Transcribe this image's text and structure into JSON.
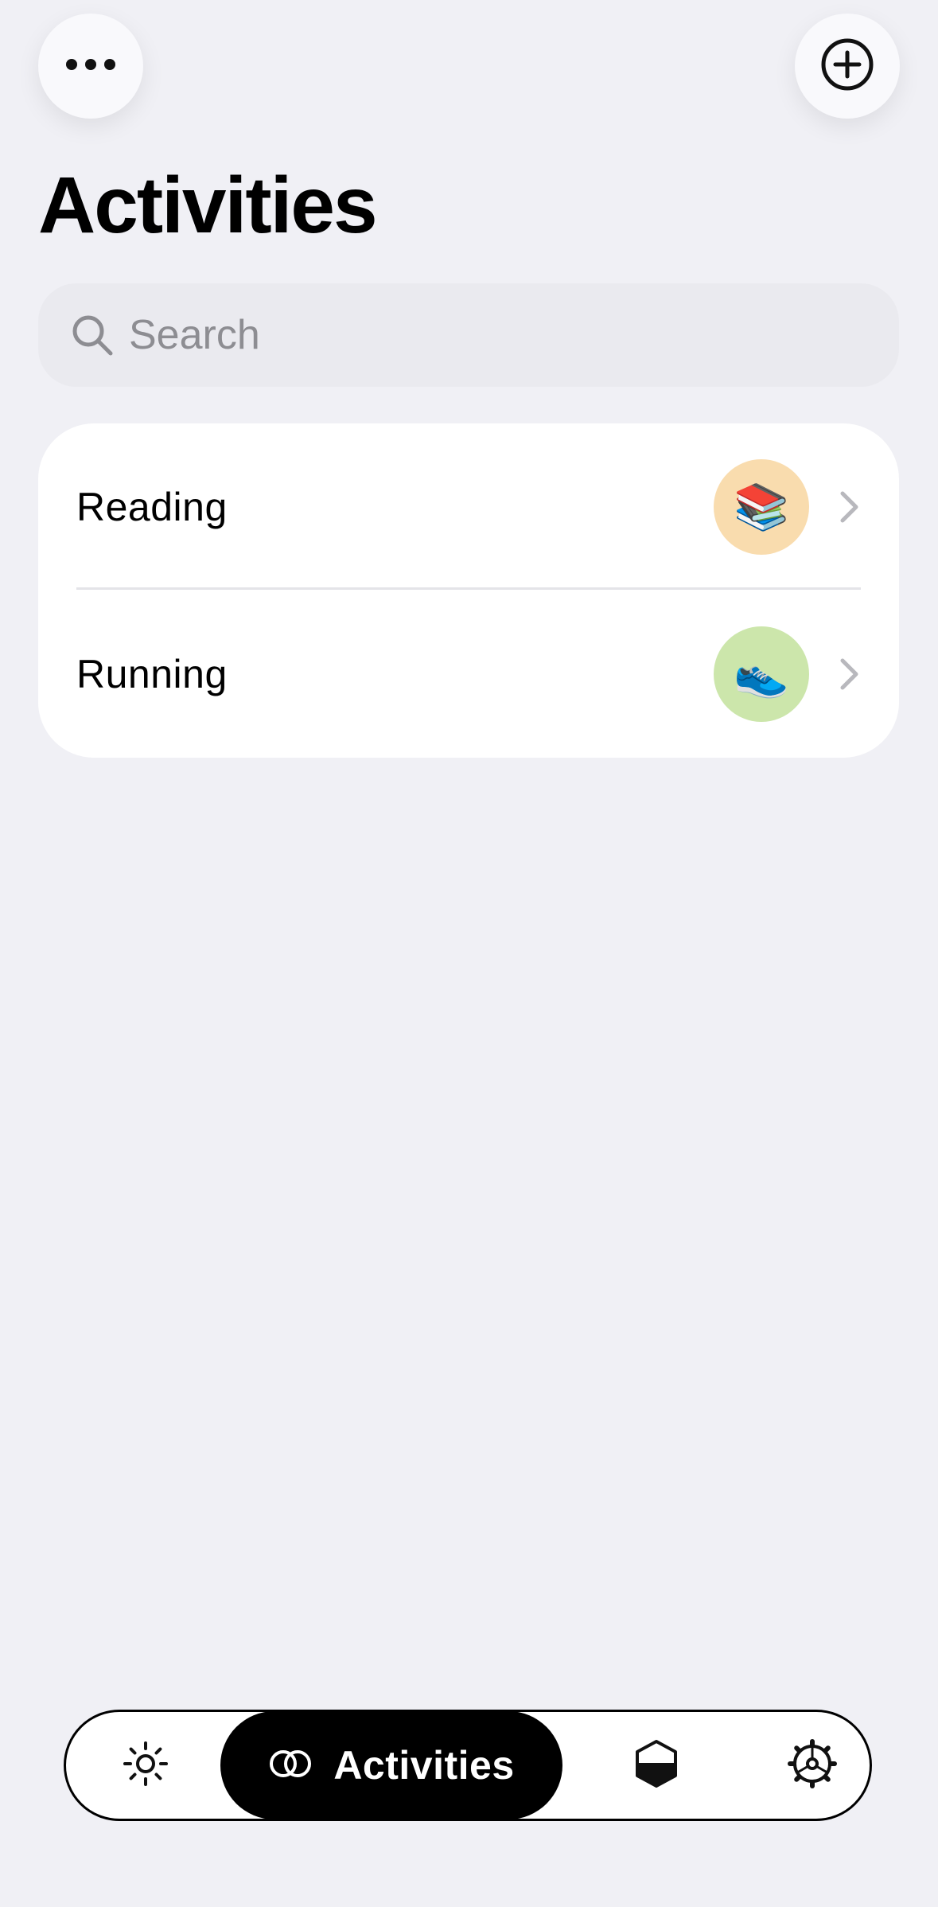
{
  "header": {
    "more_icon": "ellipsis-icon",
    "add_icon": "plus-circle-icon"
  },
  "page": {
    "title": "Activities"
  },
  "search": {
    "placeholder": "Search",
    "value": ""
  },
  "activities": [
    {
      "label": "Reading",
      "emoji": "📚",
      "badge_color": "#f9dcae"
    },
    {
      "label": "Running",
      "emoji": "👟",
      "badge_color": "#cce6ab"
    }
  ],
  "tabbar": {
    "tabs": [
      {
        "id": "today",
        "icon": "sun-icon",
        "label": ""
      },
      {
        "id": "activities",
        "icon": "overlapping-circles-icon",
        "label": "Activities",
        "active": true
      },
      {
        "id": "stats",
        "icon": "hexagon-half-icon",
        "label": ""
      },
      {
        "id": "settings",
        "icon": "gear-icon",
        "label": ""
      }
    ]
  },
  "colors": {
    "background": "#f0f0f5",
    "card": "#ffffff",
    "accent": "#000000",
    "placeholder": "#8d8d92"
  }
}
